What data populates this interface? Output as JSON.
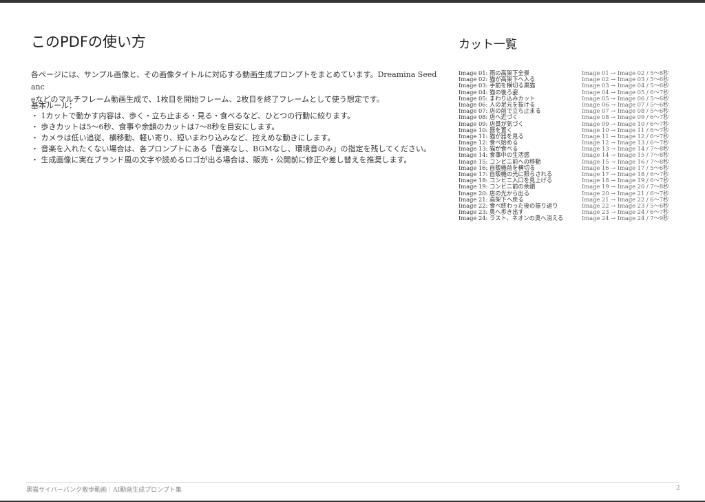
{
  "page": {
    "title": "このPDFの使い方",
    "intro_line1": "各ページには、サンプル画像と、その画像タイトルに対応する動画生成プロンプトをまとめています。Dreamina Seedanc",
    "intro_line2": "eなどのマルチフレーム動画生成で、1枚目を開始フレーム、2枚目を終了フレームとして使う想定です。",
    "rules_title": "基本ルール：",
    "rules": [
      "1カットで動かす内容は、歩く・立ち止まる・見る・食べるなど、ひとつの行動に絞ります。",
      "歩きカットは5〜6秒、食事や余韻のカットは7〜8秒を目安にします。",
      "カメラは低い追従、横移動、軽い寄り、短いまわり込みなど、控えめな動きにします。",
      "音楽を入れたくない場合は、各プロンプトにある「音楽なし、BGMなし、環境音のみ」の指定を残してください。",
      "生成画像に実在ブランド風の文字や読めるロゴが出る場合は、販売・公開前に修正や差し替えを推奨します。"
    ]
  },
  "cut_list": {
    "title": "カット一覧",
    "items": [
      {
        "title": "Image 01: 雨の高架下全景",
        "range": "Image 01 → Image 02 / 5〜8秒"
      },
      {
        "title": "Image 02: 猫が高架下へ入る",
        "range": "Image 02 → Image 03 / 5〜6秒"
      },
      {
        "title": "Image 03: 手前を横切る黒猫",
        "range": "Image 03 → Image 04 / 5〜6秒"
      },
      {
        "title": "Image 04: 猫の後ろ姿",
        "range": "Image 04 → Image 05 / 6〜7秒"
      },
      {
        "title": "Image 05: まわり込みカット",
        "range": "Image 05 → Image 06 / 5〜6秒"
      },
      {
        "title": "Image 06: 人の足元を抜ける",
        "range": "Image 06 → Image 07 / 5〜6秒"
      },
      {
        "title": "Image 07: 店の前で立ち止まる",
        "range": "Image 07 → Image 08 / 5〜6秒"
      },
      {
        "title": "Image 08: 店へ近づく",
        "range": "Image 08 → Image 09 / 6〜7秒"
      },
      {
        "title": "Image 09: 店員が気づく",
        "range": "Image 09 → Image 10 / 6〜7秒"
      },
      {
        "title": "Image 10: 器を置く",
        "range": "Image 10 → Image 11 / 6〜7秒"
      },
      {
        "title": "Image 11: 猫が器を見る",
        "range": "Image 11 → Image 12 / 6〜7秒"
      },
      {
        "title": "Image 12: 食べ始める",
        "range": "Image 12 → Image 13 / 6〜7秒"
      },
      {
        "title": "Image 13: 猫が食べる",
        "range": "Image 13 → Image 14 / 7〜8秒"
      },
      {
        "title": "Image 14: 食事中の生活感",
        "range": "Image 14 → Image 15 / 7〜8秒"
      },
      {
        "title": "Image 15: コンビニ前への移動",
        "range": "Image 15 → Image 16 / 7〜8秒"
      },
      {
        "title": "Image 16: 自販機前を横切る",
        "range": "Image 16 → Image 17 / 5〜6秒"
      },
      {
        "title": "Image 17: 自販機の光に照らされる",
        "range": "Image 17 → Image 18 / 6〜7秒"
      },
      {
        "title": "Image 18: コンビニ入口を見上げる",
        "range": "Image 18 → Image 19 / 6〜7秒"
      },
      {
        "title": "Image 19: コンビニ前の余韻",
        "range": "Image 19 → Image 20 / 7〜8秒"
      },
      {
        "title": "Image 20: 店の光から出る",
        "range": "Image 20 → Image 21 / 6〜7秒"
      },
      {
        "title": "Image 21: 高架下へ戻る",
        "range": "Image 21 → Image 22 / 6〜7秒"
      },
      {
        "title": "Image 22: 食べ終わった後の振り返り",
        "range": "Image 22 → Image 23 / 5〜6秒"
      },
      {
        "title": "Image 23: 奥へ歩き出す",
        "range": "Image 23 → Image 24 / 6〜7秒"
      },
      {
        "title": "Image 24: ラスト、ネオンの奥へ消える",
        "range": "Image 24 → Image 24 / 7〜9秒"
      }
    ]
  },
  "footer": {
    "title": "黒猫サイバーパンク散歩動画｜AI動画生成プロンプト集",
    "page_number": "2"
  }
}
